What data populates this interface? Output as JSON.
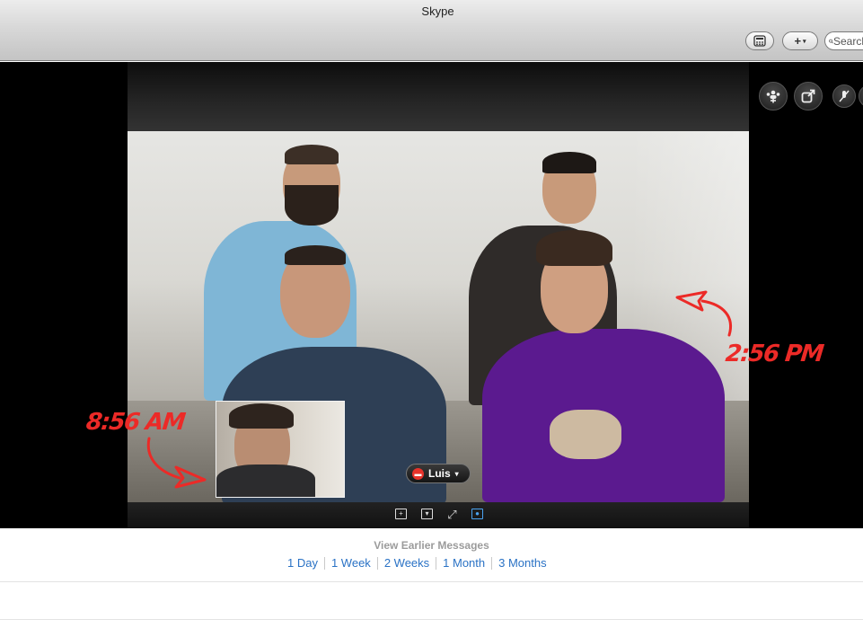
{
  "window": {
    "title": "Skype"
  },
  "toolbar": {
    "call_icon": "phone-dialpad-icon",
    "add_label": "+",
    "add_caret": "▾",
    "search_placeholder": "Search"
  },
  "call": {
    "controls": [
      "add-participant-icon",
      "popout-icon",
      "mute-mic-icon"
    ],
    "participant_name": "Luis",
    "participant_caret": "▾",
    "bottom_icons": [
      "add-video-icon",
      "collapse-icon",
      "fullscreen-icon",
      "contact-card-icon"
    ]
  },
  "annotations": {
    "left_time": "8:56 AM",
    "right_time": "2:56 PM",
    "color": "#ec2a27"
  },
  "history": {
    "view_earlier": "View Earlier Messages",
    "ranges": [
      "1 Day",
      "1 Week",
      "2 Weeks",
      "1 Month",
      "3 Months"
    ]
  },
  "colors": {
    "link": "#2a72c5",
    "active_icon": "#4aa3f0"
  }
}
